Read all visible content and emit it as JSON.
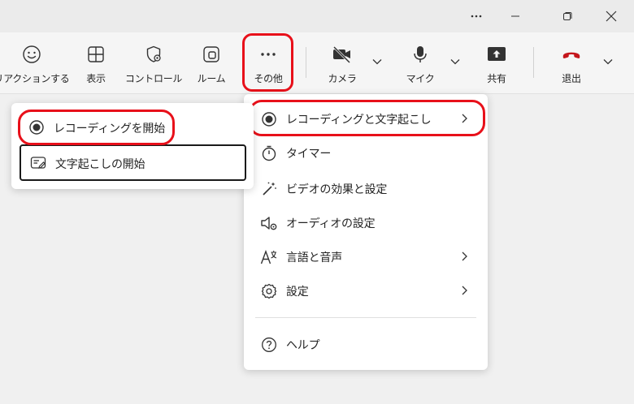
{
  "window": {
    "more_label": "…"
  },
  "toolbar": {
    "reactions": "リアクションする",
    "view": "表示",
    "controls": "コントロール",
    "rooms": "ルーム",
    "more": "その他",
    "camera": "カメラ",
    "mic": "マイク",
    "share": "共有",
    "leave": "退出"
  },
  "more_menu": {
    "items": [
      {
        "label": "レコーディングと文字起こし",
        "icon": "record-icon",
        "submenu": true
      },
      {
        "label": "タイマー",
        "icon": "timer-icon",
        "submenu": false
      },
      {
        "label": "ビデオの効果と設定",
        "icon": "magic-wand-icon",
        "submenu": false
      },
      {
        "label": "オーディオの設定",
        "icon": "speaker-settings-icon",
        "submenu": false
      },
      {
        "label": "言語と音声",
        "icon": "language-icon",
        "submenu": true
      },
      {
        "label": "設定",
        "icon": "gear-icon",
        "submenu": true
      },
      {
        "label": "ヘルプ",
        "icon": "help-icon",
        "submenu": false
      }
    ]
  },
  "submenu": {
    "start_recording": "レコーディングを開始",
    "start_transcription": "文字起こしの開始"
  },
  "colors": {
    "highlight": "#e8101a",
    "leave_red": "#c4161c",
    "panel_bg": "#ffffff",
    "toolbar_bg": "#f5f5f5"
  }
}
